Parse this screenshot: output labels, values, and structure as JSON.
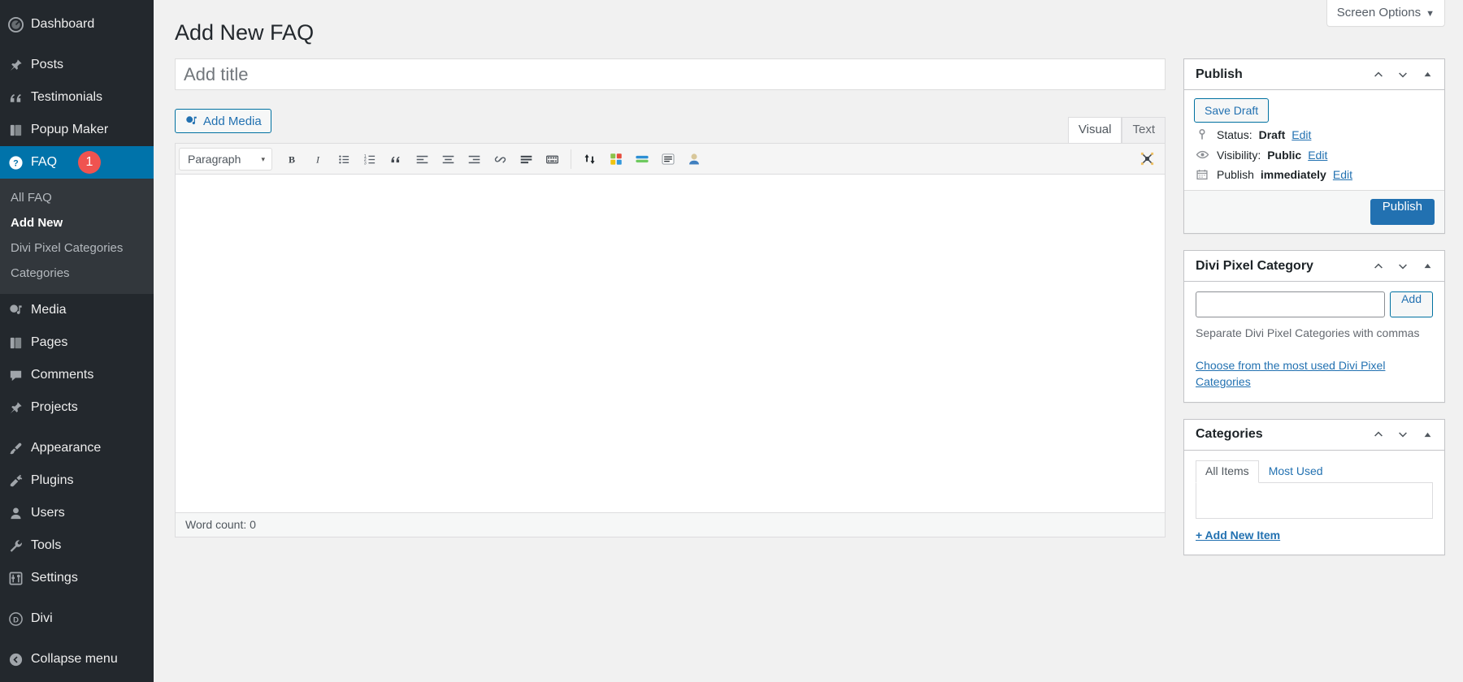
{
  "sidebar": {
    "items": [
      {
        "label": "Dashboard",
        "icon": "dashboard-icon"
      },
      {
        "label": "Posts",
        "icon": "pin-icon"
      },
      {
        "label": "Testimonials",
        "icon": "quote-icon"
      },
      {
        "label": "Popup Maker",
        "icon": "book-icon"
      },
      {
        "label": "FAQ",
        "icon": "question-circle-icon",
        "current": true,
        "badge": "1"
      },
      {
        "label": "Media",
        "icon": "media-icon"
      },
      {
        "label": "Pages",
        "icon": "pages-icon"
      },
      {
        "label": "Comments",
        "icon": "comment-icon"
      },
      {
        "label": "Projects",
        "icon": "pin-icon"
      },
      {
        "label": "Appearance",
        "icon": "brush-icon"
      },
      {
        "label": "Plugins",
        "icon": "plug-icon"
      },
      {
        "label": "Users",
        "icon": "user-icon"
      },
      {
        "label": "Tools",
        "icon": "wrench-icon"
      },
      {
        "label": "Settings",
        "icon": "sliders-icon"
      },
      {
        "label": "Divi",
        "icon": "divi-icon"
      },
      {
        "label": "Collapse menu",
        "icon": "collapse-arrow-icon"
      }
    ],
    "submenu": [
      {
        "label": "All FAQ"
      },
      {
        "label": "Add New",
        "current": true
      },
      {
        "label": "Divi Pixel Categories"
      },
      {
        "label": "Categories"
      }
    ],
    "colors": {
      "background": "#23282d",
      "submenu_background": "#32373c",
      "current_highlight": "#0073aa",
      "badge": "#ef5350"
    }
  },
  "screen_options": {
    "label": "Screen Options",
    "caret": "▼"
  },
  "page": {
    "title": "Add New FAQ"
  },
  "title_field": {
    "placeholder": "Add title",
    "value": ""
  },
  "editor": {
    "add_media_label": "Add Media",
    "tabs": [
      {
        "label": "Visual",
        "active": true
      },
      {
        "label": "Text",
        "active": false
      }
    ],
    "format_select": {
      "value": "Paragraph",
      "caret": "▾"
    },
    "toolbar_buttons": [
      {
        "name": "bold-icon",
        "title": "Bold"
      },
      {
        "name": "italic-icon",
        "title": "Italic"
      },
      {
        "name": "bulleted-list-icon",
        "title": "Bulleted list"
      },
      {
        "name": "numbered-list-icon",
        "title": "Numbered list"
      },
      {
        "name": "blockquote-icon",
        "title": "Blockquote"
      },
      {
        "name": "align-left-icon",
        "title": "Align left"
      },
      {
        "name": "align-center-icon",
        "title": "Align center"
      },
      {
        "name": "align-right-icon",
        "title": "Align right"
      },
      {
        "name": "link-icon",
        "title": "Insert/edit link"
      },
      {
        "name": "read-more-icon",
        "title": "Insert Read More tag"
      },
      {
        "name": "toolbar-toggle-icon",
        "title": "Toolbar Toggle"
      },
      {
        "name": "sort-arrows-icon",
        "title": "Sorting"
      },
      {
        "name": "color-blocks-icon",
        "title": "Color blocks"
      },
      {
        "name": "green-bars-icon",
        "title": "Bars"
      },
      {
        "name": "lines-card-icon",
        "title": "Lines card"
      },
      {
        "name": "avatar-icon",
        "title": "Avatar"
      }
    ],
    "fullscreen_icon": "fullscreen-icon",
    "status_text": "Word count: 0",
    "content": ""
  },
  "publish_box": {
    "title": "Publish",
    "save_draft_label": "Save Draft",
    "rows": [
      {
        "icon": "key-icon",
        "prefix": "Status:",
        "value": "Draft",
        "suffix": "",
        "edit": "Edit"
      },
      {
        "icon": "eye-icon",
        "prefix": "Visibility:",
        "value": "Public",
        "suffix": "",
        "edit": "Edit"
      },
      {
        "icon": "calendar-icon",
        "prefix": "Publish",
        "value": "immediately",
        "suffix": "",
        "edit": "Edit"
      }
    ],
    "publish_label": "Publish"
  },
  "divi_pixel_category_box": {
    "title": "Divi Pixel Category",
    "input_value": "",
    "add_label": "Add",
    "hint": "Separate Divi Pixel Categories with commas",
    "cloud_link": "Choose from the most used Divi Pixel Categories"
  },
  "categories_box": {
    "title": "Categories",
    "tabs": [
      {
        "label": "All Items",
        "active": true
      },
      {
        "label": "Most Used",
        "active": false
      }
    ],
    "items": [],
    "add_new_label": "+ Add New Item"
  },
  "handle_icons": {
    "up": "chevron-up-icon",
    "down": "chevron-down-icon",
    "toggle": "triangle-up-icon"
  }
}
